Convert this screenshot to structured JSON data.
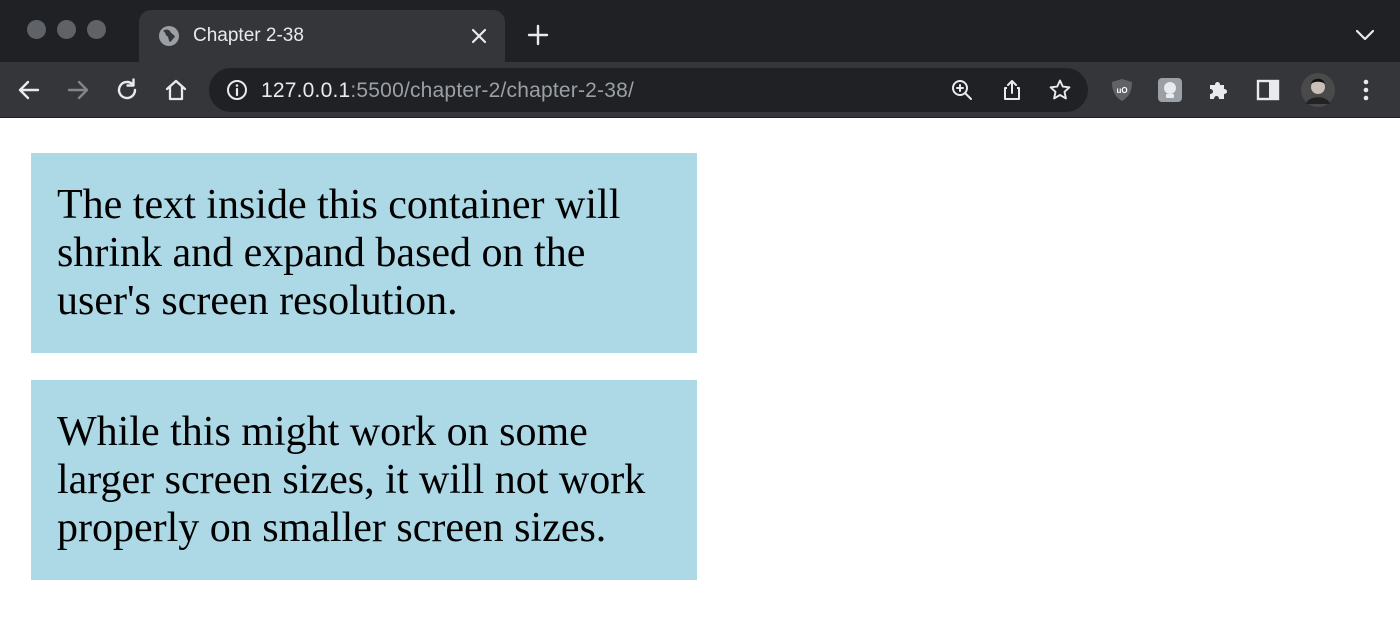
{
  "browser": {
    "tab": {
      "title": "Chapter 2-38",
      "icon": "globe-icon"
    },
    "toolbar": {
      "url_host": "127.0.0.1",
      "url_rest": ":5500/chapter-2/chapter-2-38/"
    },
    "extensions": [
      "ublock-origin-icon",
      "grammarly-icon",
      "puzzle-extensions-icon",
      "side-panel-icon",
      "profile-avatar"
    ]
  },
  "page": {
    "paragraphs": [
      "The text inside this container will shrink and expand based on the user's screen resolution.",
      "While this might work on some larger screen sizes, it will not work properly on smaller screen sizes."
    ],
    "container_background": "#add8e6"
  }
}
